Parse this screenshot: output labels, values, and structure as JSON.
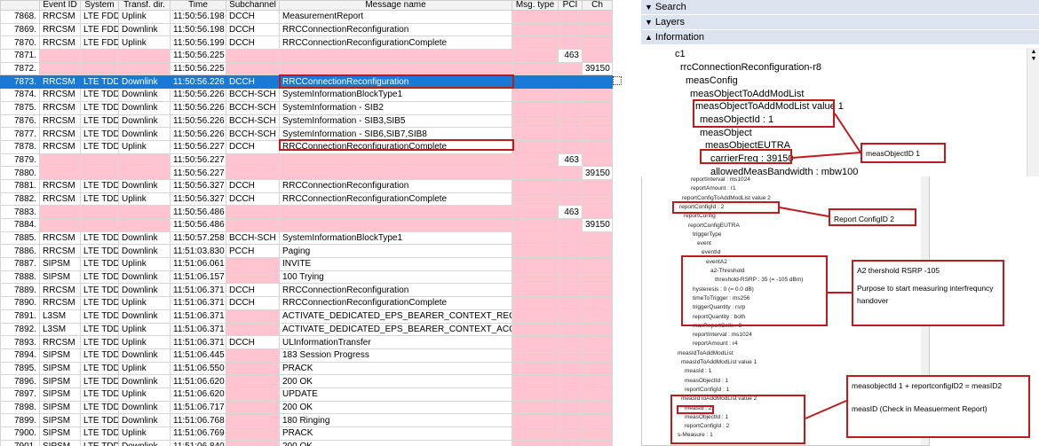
{
  "columns": [
    "Event ID",
    "System",
    "Transf. dir.",
    "Time",
    "Subchannel",
    "Message name",
    "Msg. type",
    "PCI",
    "Ch"
  ],
  "rows": [
    {
      "no": "7868.",
      "event": "RRCSM",
      "system": "LTE FDD",
      "dir": "Uplink",
      "time": "11:50:56.198",
      "sub": "DCCH",
      "msg": "MeasurementReport",
      "pci": "",
      "ch": ""
    },
    {
      "no": "7869.",
      "event": "RRCSM",
      "system": "LTE FDD",
      "dir": "Downlink",
      "time": "11:50:56.198",
      "sub": "DCCH",
      "msg": "RRCConnectionReconfiguration",
      "pci": "",
      "ch": ""
    },
    {
      "no": "7870.",
      "event": "RRCSM",
      "system": "LTE FDD",
      "dir": "Uplink",
      "time": "11:50:56.199",
      "sub": "DCCH",
      "msg": "RRCConnectionReconfigurationComplete",
      "pci": "",
      "ch": ""
    },
    {
      "no": "7871.",
      "event": "",
      "system": "",
      "dir": "",
      "time": "11:50:56.225",
      "sub": "",
      "msg": "",
      "pci": "463",
      "ch": ""
    },
    {
      "no": "7872.",
      "event": "",
      "system": "",
      "dir": "",
      "time": "11:50:56.225",
      "sub": "",
      "msg": "",
      "pci": "",
      "ch": "39150"
    },
    {
      "no": "7873.",
      "event": "RRCSM",
      "system": "LTE TDD",
      "dir": "Downlink",
      "time": "11:50:56.226",
      "sub": "DCCH",
      "msg": "RRCConnectionReconfiguration",
      "pci": "",
      "ch": ""
    },
    {
      "no": "7874.",
      "event": "RRCSM",
      "system": "LTE TDD",
      "dir": "Downlink",
      "time": "11:50:56.226",
      "sub": "BCCH-SCH",
      "msg": "SystemInformationBlockType1",
      "pci": "",
      "ch": ""
    },
    {
      "no": "7875.",
      "event": "RRCSM",
      "system": "LTE TDD",
      "dir": "Downlink",
      "time": "11:50:56.226",
      "sub": "BCCH-SCH",
      "msg": "SystemInformation - SIB2",
      "pci": "",
      "ch": ""
    },
    {
      "no": "7876.",
      "event": "RRCSM",
      "system": "LTE TDD",
      "dir": "Downlink",
      "time": "11:50:56.226",
      "sub": "BCCH-SCH",
      "msg": "SystemInformation - SIB3,SIB5",
      "pci": "",
      "ch": ""
    },
    {
      "no": "7877.",
      "event": "RRCSM",
      "system": "LTE TDD",
      "dir": "Downlink",
      "time": "11:50:56.226",
      "sub": "BCCH-SCH",
      "msg": "SystemInformation - SIB6,SIB7,SIB8",
      "pci": "",
      "ch": ""
    },
    {
      "no": "7878.",
      "event": "RRCSM",
      "system": "LTE TDD",
      "dir": "Uplink",
      "time": "11:50:56.227",
      "sub": "DCCH",
      "msg": "RRCConnectionReconfigurationComplete",
      "pci": "",
      "ch": ""
    },
    {
      "no": "7879.",
      "event": "",
      "system": "",
      "dir": "",
      "time": "11:50:56.227",
      "sub": "",
      "msg": "",
      "pci": "463",
      "ch": ""
    },
    {
      "no": "7880.",
      "event": "",
      "system": "",
      "dir": "",
      "time": "11:50:56.227",
      "sub": "",
      "msg": "",
      "pci": "",
      "ch": "39150"
    },
    {
      "no": "7881.",
      "event": "RRCSM",
      "system": "LTE TDD",
      "dir": "Downlink",
      "time": "11:50:56.327",
      "sub": "DCCH",
      "msg": "RRCConnectionReconfiguration",
      "pci": "",
      "ch": ""
    },
    {
      "no": "7882.",
      "event": "RRCSM",
      "system": "LTE TDD",
      "dir": "Uplink",
      "time": "11:50:56.327",
      "sub": "DCCH",
      "msg": "RRCConnectionReconfigurationComplete",
      "pci": "",
      "ch": ""
    },
    {
      "no": "7883.",
      "event": "",
      "system": "",
      "dir": "",
      "time": "11:50:56.486",
      "sub": "",
      "msg": "",
      "pci": "463",
      "ch": ""
    },
    {
      "no": "7884.",
      "event": "",
      "system": "",
      "dir": "",
      "time": "11:50:56.486",
      "sub": "",
      "msg": "",
      "pci": "",
      "ch": "39150"
    },
    {
      "no": "7885.",
      "event": "RRCSM",
      "system": "LTE TDD",
      "dir": "Downlink",
      "time": "11:50:57.258",
      "sub": "BCCH-SCH",
      "msg": "SystemInformationBlockType1",
      "pci": "",
      "ch": ""
    },
    {
      "no": "7886.",
      "event": "RRCSM",
      "system": "LTE TDD",
      "dir": "Downlink",
      "time": "11:51:03.830",
      "sub": "PCCH",
      "msg": "Paging",
      "pci": "",
      "ch": ""
    },
    {
      "no": "7887.",
      "event": "SIPSM",
      "system": "LTE TDD",
      "dir": "Uplink",
      "time": "11:51:06.061",
      "sub": "",
      "msg": "INVITE",
      "pci": "",
      "ch": ""
    },
    {
      "no": "7888.",
      "event": "SIPSM",
      "system": "LTE TDD",
      "dir": "Downlink",
      "time": "11:51:06.157",
      "sub": "",
      "msg": "100 Trying",
      "pci": "",
      "ch": ""
    },
    {
      "no": "7889.",
      "event": "RRCSM",
      "system": "LTE TDD",
      "dir": "Downlink",
      "time": "11:51:06.371",
      "sub": "DCCH",
      "msg": "RRCConnectionReconfiguration",
      "pci": "",
      "ch": ""
    },
    {
      "no": "7890.",
      "event": "RRCSM",
      "system": "LTE TDD",
      "dir": "Uplink",
      "time": "11:51:06.371",
      "sub": "DCCH",
      "msg": "RRCConnectionReconfigurationComplete",
      "pci": "",
      "ch": ""
    },
    {
      "no": "7891.",
      "event": "L3SM",
      "system": "LTE TDD",
      "dir": "Downlink",
      "time": "11:51:06.371",
      "sub": "",
      "msg": "ACTIVATE_DEDICATED_EPS_BEARER_CONTEXT_REQUEST",
      "pci": "",
      "ch": ""
    },
    {
      "no": "7892.",
      "event": "L3SM",
      "system": "LTE TDD",
      "dir": "Uplink",
      "time": "11:51:06.371",
      "sub": "",
      "msg": "ACTIVATE_DEDICATED_EPS_BEARER_CONTEXT_ACCEPT",
      "pci": "",
      "ch": ""
    },
    {
      "no": "7893.",
      "event": "RRCSM",
      "system": "LTE TDD",
      "dir": "Uplink",
      "time": "11:51:06.371",
      "sub": "DCCH",
      "msg": "ULInformationTransfer",
      "pci": "",
      "ch": ""
    },
    {
      "no": "7894.",
      "event": "SIPSM",
      "system": "LTE TDD",
      "dir": "Downlink",
      "time": "11:51:06.445",
      "sub": "",
      "msg": "183 Session Progress",
      "pci": "",
      "ch": ""
    },
    {
      "no": "7895.",
      "event": "SIPSM",
      "system": "LTE TDD",
      "dir": "Uplink",
      "time": "11:51:06.550",
      "sub": "",
      "msg": "PRACK",
      "pci": "",
      "ch": ""
    },
    {
      "no": "7896.",
      "event": "SIPSM",
      "system": "LTE TDD",
      "dir": "Downlink",
      "time": "11:51:06.620",
      "sub": "",
      "msg": "200 OK",
      "pci": "",
      "ch": ""
    },
    {
      "no": "7897.",
      "event": "SIPSM",
      "system": "LTE TDD",
      "dir": "Uplink",
      "time": "11:51:06.620",
      "sub": "",
      "msg": "UPDATE",
      "pci": "",
      "ch": ""
    },
    {
      "no": "7898.",
      "event": "SIPSM",
      "system": "LTE TDD",
      "dir": "Downlink",
      "time": "11:51:06.717",
      "sub": "",
      "msg": "200 OK",
      "pci": "",
      "ch": ""
    },
    {
      "no": "7899.",
      "event": "SIPSM",
      "system": "LTE TDD",
      "dir": "Downlink",
      "time": "11:51:06.768",
      "sub": "",
      "msg": "180 Ringing",
      "pci": "",
      "ch": ""
    },
    {
      "no": "7900.",
      "event": "SIPSM",
      "system": "LTE TDD",
      "dir": "Uplink",
      "time": "11:51:06.769",
      "sub": "",
      "msg": "PRACK",
      "pci": "",
      "ch": ""
    },
    {
      "no": "7901.",
      "event": "SIPSM",
      "system": "LTE TDD",
      "dir": "Downlink",
      "time": "11:51:06.840",
      "sub": "",
      "msg": "200 OK",
      "pci": "",
      "ch": ""
    }
  ],
  "selected_row": "7873.",
  "highlighted_rows": [
    "7873.",
    "7878."
  ],
  "colors": {
    "selection": "#1979d6",
    "empty_cell": "#ffc4cf",
    "section_header": "#dce4ef",
    "annotation": "#c21a1a"
  },
  "panels": {
    "search": "Search",
    "layers": "Layers",
    "information": "Information",
    "search_icon": "triangle-down-icon",
    "layers_icon": "triangle-down-icon",
    "information_icon": "triangle-up-icon"
  },
  "tree_top": [
    "c1",
    "rrcConnectionReconfiguration-r8",
    "measConfig",
    "measObjectToAddModList",
    "measObjectToAddModList value 1",
    "measObjectId    : 1",
    "measObject",
    "measObjectEUTRA",
    "carrierFreq    : 39150",
    "allowedMeasBandwidth    : mbw100"
  ],
  "tree_small": [
    "reportInterval : ms1024",
    "reportAmount : r1",
    "reportConfigToAddModList value 2",
    "reportConfigId : 2",
    "reportConfig",
    "reportConfigEUTRA",
    "triggerType",
    "event",
    "eventId",
    "eventA2",
    "a2-Threshold",
    "threshold-RSRP : 35 (= -105 dBm)",
    "hysteresis : 0 (= 0.0 dB)",
    "timeToTrigger : ms256",
    "triggerQuantity : rsrp",
    "reportQuantity : both",
    "maxReportCells : 8",
    "reportInterval : ms1024",
    "reportAmount : r4",
    "measIdToAddModList",
    "measIdToAddModList value 1",
    "measId : 1",
    "measObjectId : 1",
    "reportConfigId : 1",
    "measIdToAddModList value 2",
    "measId : 2",
    "measObjectId : 1",
    "reportConfigId : 2",
    "s-Measure : 1"
  ],
  "notes": {
    "measobject": "measObjectID 1",
    "reportconfig": "Report ConfigID 2",
    "a2_line1": "A2 thershold RSRP -105",
    "a2_line2": "Purpose to start measuring interfrequncy handover",
    "measid_line1": "measobjectId 1 + reportconfigID2 = measID2",
    "measid_line2": "measID (Check in Measuerment Report)"
  }
}
